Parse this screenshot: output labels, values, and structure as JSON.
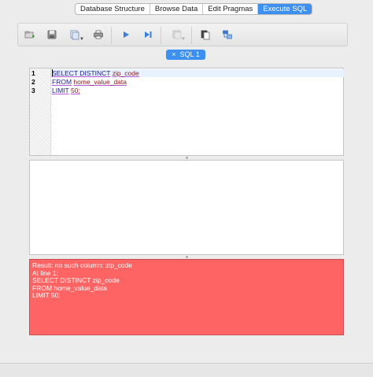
{
  "tabs": [
    {
      "label": "Database Structure",
      "active": false
    },
    {
      "label": "Browse Data",
      "active": false
    },
    {
      "label": "Edit Pragmas",
      "active": false
    },
    {
      "label": "Execute SQL",
      "active": true
    }
  ],
  "toolbar": {
    "icons": [
      "open-tab-icon",
      "open-sql-file-icon",
      "save-sql-file-icon",
      "print-icon",
      "execute-all-icon",
      "execute-current-line-icon",
      "stop-execution-icon",
      "save-results-icon",
      "find-replace-icon"
    ]
  },
  "sql_tab": {
    "label": "SQL 1",
    "close_glyph": "×"
  },
  "editor": {
    "lines": [
      {
        "number": "1",
        "keyword": "SELECT DISTINCT",
        "rest": "zip_code"
      },
      {
        "number": "2",
        "keyword": "FROM",
        "rest": "home_value_data"
      },
      {
        "number": "3",
        "keyword": "LIMIT",
        "rest": "50;"
      }
    ]
  },
  "message": {
    "lines": [
      "Result: no such column: zip_code",
      "At line 1:",
      "SELECT DISTINCT zip_code",
      "FROM home_value_data",
      "LIMIT 50;"
    ]
  },
  "colors": {
    "accent": "#3d8ff0",
    "error_bg": "#ff6464"
  }
}
